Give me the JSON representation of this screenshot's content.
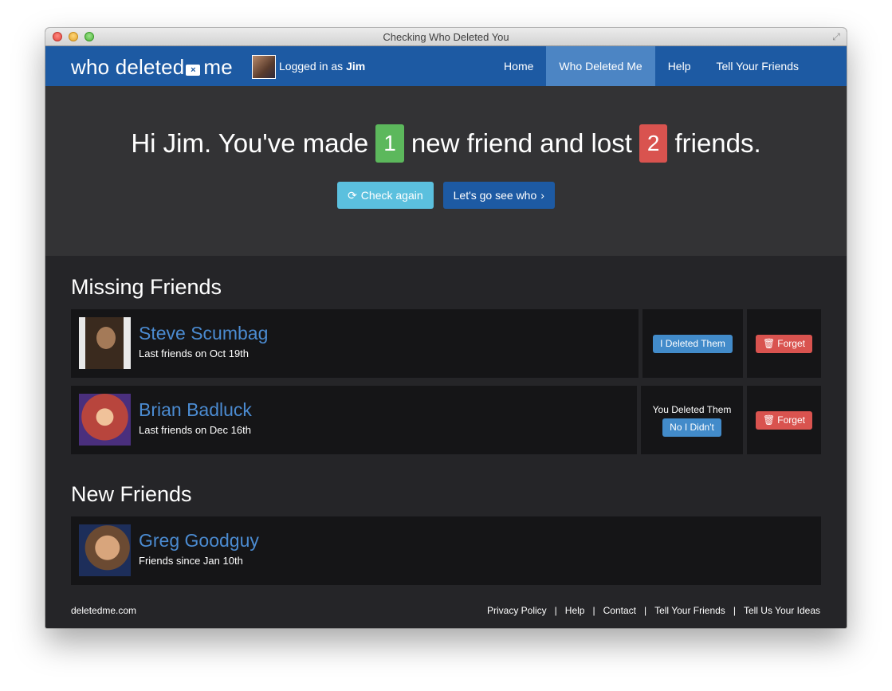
{
  "window": {
    "title": "Checking Who Deleted You"
  },
  "navbar": {
    "brand_part1": "who deleted",
    "brand_part2": "me",
    "logged_in_prefix": "Logged in as",
    "username": "Jim",
    "items": [
      {
        "label": "Home",
        "active": false
      },
      {
        "label": "Who Deleted Me",
        "active": true
      },
      {
        "label": "Help",
        "active": false
      },
      {
        "label": "Tell Your Friends",
        "active": false
      }
    ]
  },
  "hero": {
    "greeting": "Hi Jim. You've made",
    "new_count": "1",
    "middle": "new friend and lost",
    "lost_count": "2",
    "end": "friends.",
    "check_again": "Check again",
    "go_see": "Let's go see who"
  },
  "missing": {
    "title": "Missing Friends",
    "people": [
      {
        "name": "Steve Scumbag",
        "sub": "Last friends on Oct 19th",
        "action": "I Deleted Them",
        "forget": "Forget"
      },
      {
        "name": "Brian Badluck",
        "sub": "Last friends on Dec 16th",
        "deleted_label": "You Deleted Them",
        "action": "No I Didn't",
        "forget": "Forget"
      }
    ]
  },
  "new_friends": {
    "title": "New Friends",
    "people": [
      {
        "name": "Greg Goodguy",
        "sub": "Friends since Jan 10th"
      }
    ]
  },
  "footer": {
    "site": "deletedme.com",
    "links": [
      "Privacy Policy",
      "Help",
      "Contact",
      "Tell Your Friends",
      "Tell Us Your Ideas"
    ]
  },
  "colors": {
    "nav": "#1d5aa3",
    "nav_active": "#4c85c4",
    "green_badge": "#5cb85c",
    "red_badge": "#d9534f",
    "link_blue": "#4b8bd1"
  }
}
